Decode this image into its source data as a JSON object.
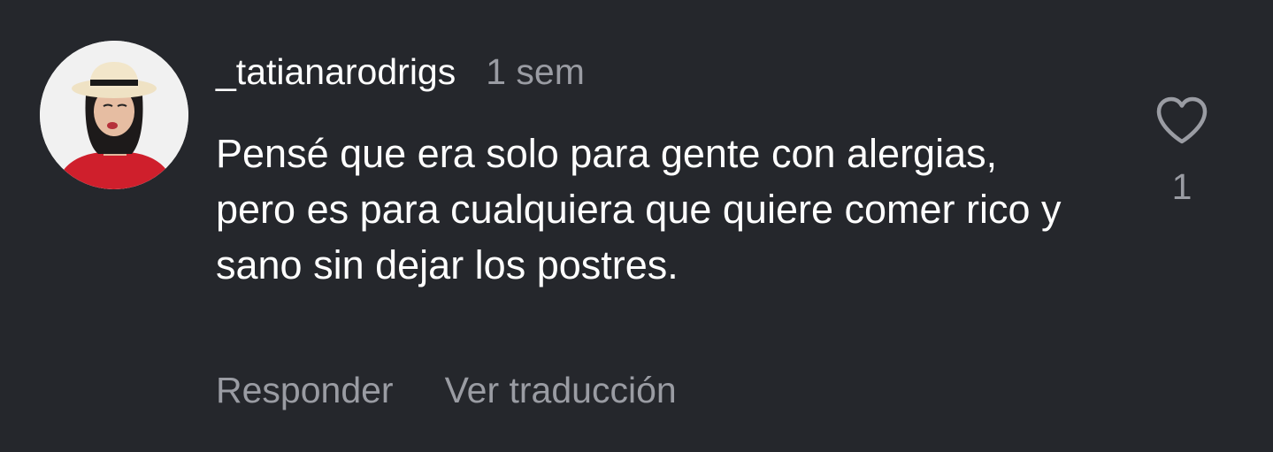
{
  "comment": {
    "username": "_tatianarodrigs",
    "timestamp": "1 sem",
    "text": "Pensé que era solo para gente con alergias, pero es para cualquiera que quiere comer rico y sano sin dejar los postres.",
    "actions": {
      "reply_label": "Responder",
      "translate_label": "Ver traducción"
    },
    "likes": {
      "icon": "heart-outline-icon",
      "count": "1"
    }
  },
  "colors": {
    "background": "#25272c",
    "primary_text": "#ffffff",
    "secondary_text": "#9a9ca3"
  }
}
